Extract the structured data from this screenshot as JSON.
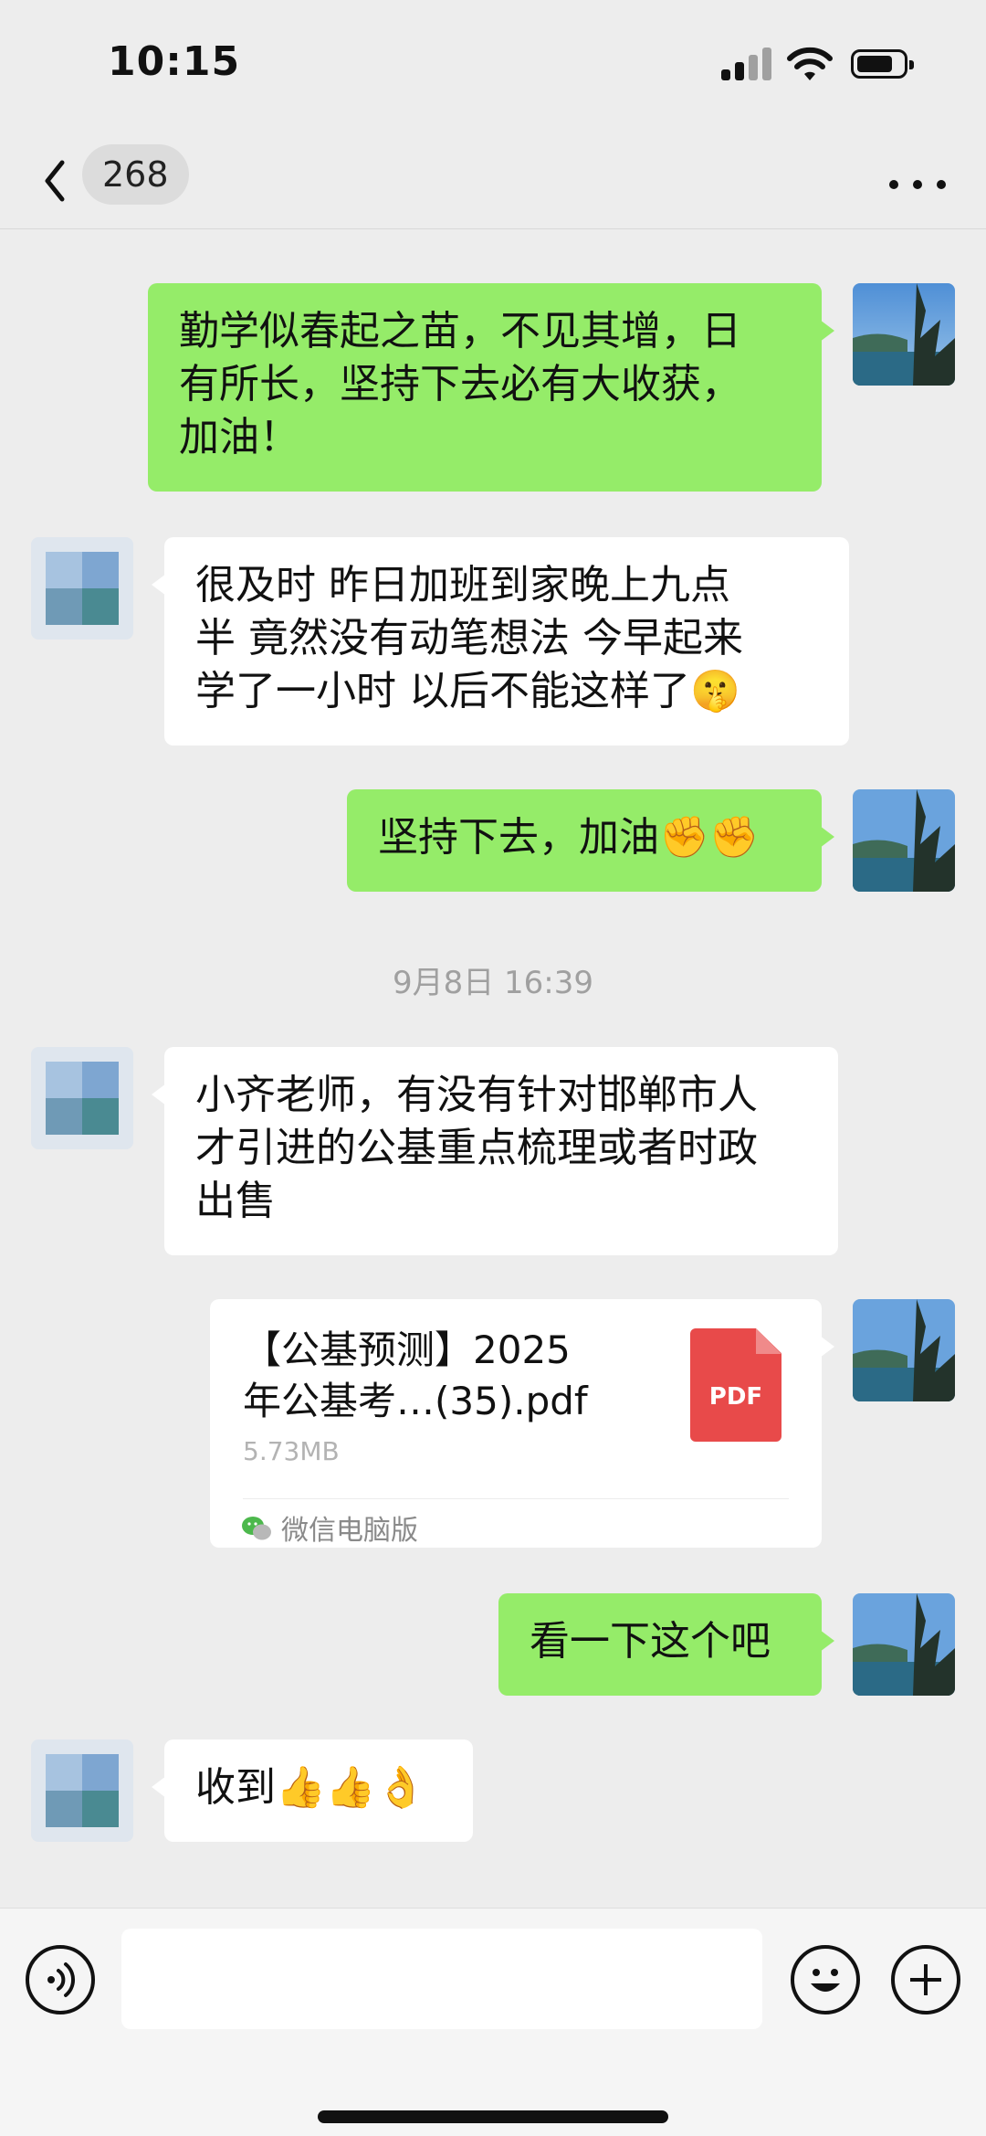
{
  "status": {
    "time": "10:15"
  },
  "nav": {
    "unread_count": "268",
    "title": ""
  },
  "messages": [
    {
      "from": "me",
      "text": "勤学似春起之苗，不见其增，日\n有所长，坚持下去必有大收获，\n加油！"
    },
    {
      "from": "other",
      "text": "很及时  昨日加班到家晚上九点\n半   竟然没有动笔想法  今早起来\n学了一小时   以后不能这样了🤫"
    },
    {
      "from": "me",
      "text": "坚持下去，加油✊✊"
    },
    {
      "timestamp": "9月8日 16:39"
    },
    {
      "from": "other",
      "text": "小齐老师，有没有针对邯郸市人\n才引进的公基重点梳理或者时政\n出售"
    },
    {
      "from": "me",
      "file": {
        "name": "【公基预测】2025\n年公基考…(35).pdf",
        "size": "5.73MB",
        "type_label": "PDF",
        "source": "微信电脑版"
      }
    },
    {
      "from": "me",
      "text": "看一下这个吧"
    },
    {
      "from": "other",
      "text": "收到👍👍👌"
    }
  ],
  "colors": {
    "green_bubble": "#95ec69",
    "white_bubble": "#ffffff",
    "background": "#ededed",
    "pdf_red": "#e84a4a"
  },
  "input": {
    "placeholder": ""
  },
  "icons": [
    "back-chevron-icon",
    "more-dots-icon",
    "voice-icon",
    "emoji-icon",
    "plus-icon",
    "pdf-icon",
    "wechat-icon"
  ]
}
